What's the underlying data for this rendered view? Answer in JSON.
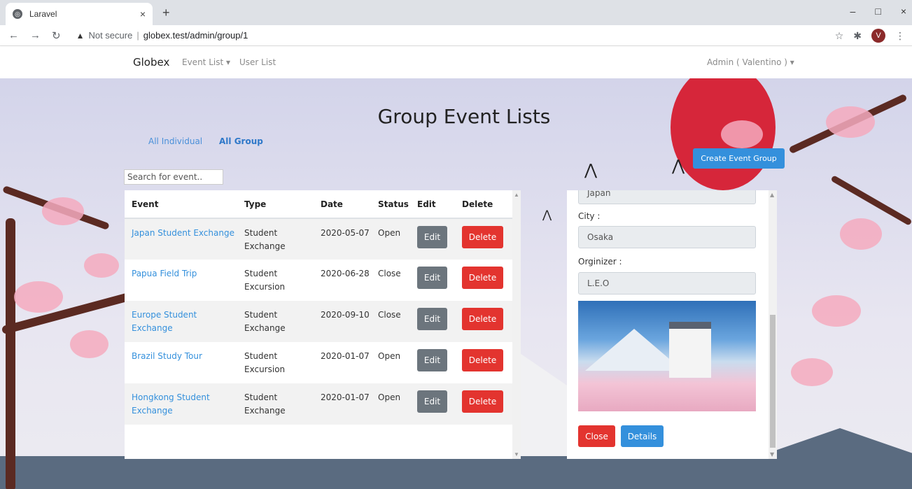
{
  "browser": {
    "tab_title": "Laravel",
    "tab_close": "×",
    "new_tab": "+",
    "security_label": "Not secure",
    "url": "globex.test/admin/group/1",
    "profile_initial": "V",
    "minimize": "–",
    "maximize": "□",
    "close": "×"
  },
  "navbar": {
    "brand": "Globex",
    "event_list": "Event List ▾",
    "user_list": "User List",
    "user_menu": "Admin ( Valentino ) ▾"
  },
  "page": {
    "title": "Group Event Lists",
    "filter_individual": "All Individual",
    "filter_group": "All Group",
    "create_button": "Create Event Group",
    "search_placeholder": "Search for event.."
  },
  "table": {
    "headers": [
      "Event",
      "Type",
      "Date",
      "Status",
      "Edit",
      "Delete"
    ],
    "edit_label": "Edit",
    "delete_label": "Delete",
    "rows": [
      {
        "event": "Japan Student Exchange",
        "type": "Student Exchange",
        "date": "2020-05-07",
        "status": "Open"
      },
      {
        "event": "Papua Field Trip",
        "type": "Student Excursion",
        "date": "2020-06-28",
        "status": "Close"
      },
      {
        "event": "Europe Student Exchange",
        "type": "Student Exchange",
        "date": "2020-09-10",
        "status": "Close"
      },
      {
        "event": "Brazil Study Tour",
        "type": "Student Excursion",
        "date": "2020-01-07",
        "status": "Open"
      },
      {
        "event": "Hongkong Student Exchange",
        "type": "Student Exchange",
        "date": "2020-01-07",
        "status": "Open"
      }
    ]
  },
  "detail": {
    "country_value": "Japan",
    "city_label": "City :",
    "city_value": "Osaka",
    "organizer_label": "Orginizer :",
    "organizer_value": "L.E.O",
    "close_button": "Close",
    "details_button": "Details"
  },
  "colors": {
    "primary": "#3490dc",
    "danger": "#e3342f",
    "secondary": "#6c757d",
    "sun": "#d6263a"
  }
}
